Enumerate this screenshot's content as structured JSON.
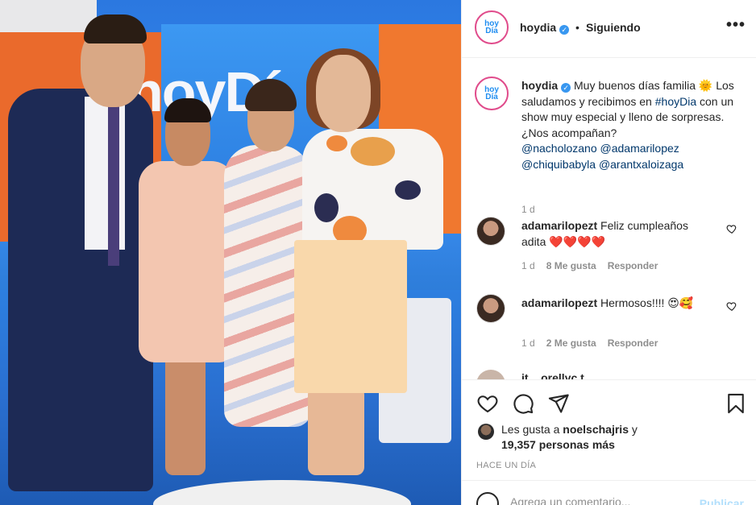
{
  "post_image": {
    "alt_scene_logo": "hoyDí"
  },
  "header": {
    "username": "hoydia",
    "separator": "•",
    "follow_status": "Siguiendo",
    "more": "•••",
    "avatar_line1": "hoy",
    "avatar_line2": "Día"
  },
  "caption": {
    "username": "hoydia",
    "text_part1": " Muy buenos días familia 🌞 Los saludamos y recibimos en ",
    "hashtag": "#hoyDia",
    "text_part2": " con un show muy especial y lleno de sorpresas. ¿Nos acompañan? ",
    "mention1": "@nacholozano",
    "mention2": "@adamarilopez",
    "mention3": "@chiquibabyla",
    "mention4": "@arantxaloizaga",
    "time": "1 d"
  },
  "comments": [
    {
      "username": "adamarilopezt",
      "text": " Feliz cumpleaños adita ",
      "emoji": "❤️❤️❤️❤️",
      "time": "1 d",
      "likes": "8 Me gusta",
      "reply": "Responder"
    },
    {
      "username": "adamarilopezt",
      "text": " Hermosos!!!! ",
      "emoji": "😍🥰",
      "time": "1 d",
      "likes": "2 Me gusta",
      "reply": "Responder"
    }
  ],
  "partial_comment": {
    "text": "it... orellyc t"
  },
  "actions": {
    "like_icon": "heart-icon",
    "comment_icon": "comment-icon",
    "share_icon": "send-icon",
    "save_icon": "bookmark-icon"
  },
  "likes": {
    "prefix": "Les gusta a ",
    "user": "noelschajris",
    "middle": " y ",
    "count": "19,357 personas más"
  },
  "time_ago": "HACE UN DÍA",
  "add_comment": {
    "placeholder": "Agrega un comentario...",
    "post_label": "Publicar"
  },
  "colors": {
    "verified": "#3897f0",
    "link": "#00376b",
    "muted": "#8e8e8e",
    "post_disabled": "#b2dffc"
  }
}
